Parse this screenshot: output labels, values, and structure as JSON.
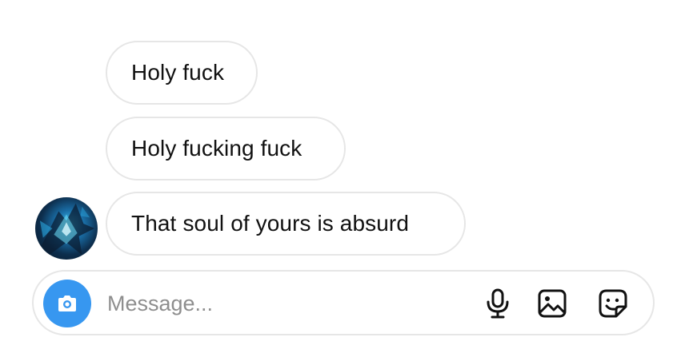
{
  "messages": [
    {
      "text": "Holy fuck"
    },
    {
      "text": "Holy fucking fuck"
    },
    {
      "parts": [
        "That",
        "soul",
        "of yours is absurd"
      ]
    }
  ],
  "composer": {
    "placeholder": "Message...",
    "accent_color": "#3797f0",
    "icons": [
      "camera-icon",
      "microphone-icon",
      "gallery-icon",
      "sticker-icon"
    ]
  },
  "avatar": {
    "icon": "avatar-image"
  }
}
